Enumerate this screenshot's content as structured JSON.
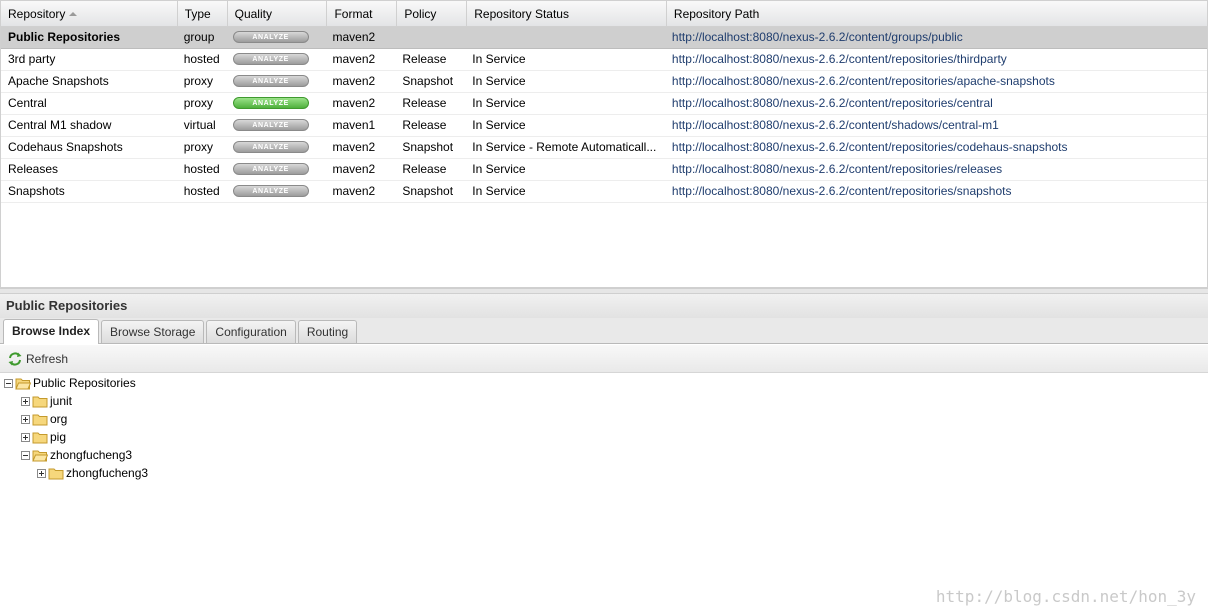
{
  "grid": {
    "columns": {
      "repository": "Repository",
      "type": "Type",
      "quality": "Quality",
      "format": "Format",
      "policy": "Policy",
      "status": "Repository Status",
      "path": "Repository Path"
    },
    "rows": [
      {
        "name": "Public Repositories",
        "type": "group",
        "analyze": "ANALYZE",
        "analyze_active": false,
        "format": "maven2",
        "policy": "",
        "status": "",
        "path": "http://localhost:8080/nexus-2.6.2/content/groups/public"
      },
      {
        "name": "3rd party",
        "type": "hosted",
        "analyze": "ANALYZE",
        "analyze_active": false,
        "format": "maven2",
        "policy": "Release",
        "status": "In Service",
        "path": "http://localhost:8080/nexus-2.6.2/content/repositories/thirdparty"
      },
      {
        "name": "Apache Snapshots",
        "type": "proxy",
        "analyze": "ANALYZE",
        "analyze_active": false,
        "format": "maven2",
        "policy": "Snapshot",
        "status": "In Service",
        "path": "http://localhost:8080/nexus-2.6.2/content/repositories/apache-snapshots"
      },
      {
        "name": "Central",
        "type": "proxy",
        "analyze": "ANALYZE",
        "analyze_active": true,
        "format": "maven2",
        "policy": "Release",
        "status": "In Service",
        "path": "http://localhost:8080/nexus-2.6.2/content/repositories/central"
      },
      {
        "name": "Central M1 shadow",
        "type": "virtual",
        "analyze": "ANALYZE",
        "analyze_active": false,
        "format": "maven1",
        "policy": "Release",
        "status": "In Service",
        "path": "http://localhost:8080/nexus-2.6.2/content/shadows/central-m1"
      },
      {
        "name": "Codehaus Snapshots",
        "type": "proxy",
        "analyze": "ANALYZE",
        "analyze_active": false,
        "format": "maven2",
        "policy": "Snapshot",
        "status": "In Service - Remote Automaticall...",
        "path": "http://localhost:8080/nexus-2.6.2/content/repositories/codehaus-snapshots"
      },
      {
        "name": "Releases",
        "type": "hosted",
        "analyze": "ANALYZE",
        "analyze_active": false,
        "format": "maven2",
        "policy": "Release",
        "status": "In Service",
        "path": "http://localhost:8080/nexus-2.6.2/content/repositories/releases"
      },
      {
        "name": "Snapshots",
        "type": "hosted",
        "analyze": "ANALYZE",
        "analyze_active": false,
        "format": "maven2",
        "policy": "Snapshot",
        "status": "In Service",
        "path": "http://localhost:8080/nexus-2.6.2/content/repositories/snapshots"
      }
    ]
  },
  "detail": {
    "title": "Public Repositories",
    "tabs": [
      "Browse Index",
      "Browse Storage",
      "Configuration",
      "Routing"
    ],
    "toolbar": {
      "refresh_label": "Refresh"
    },
    "tree": {
      "root": "Public Repositories",
      "children": [
        "junit",
        "org",
        "pig",
        "zhongfucheng3"
      ],
      "grandchild": "zhongfucheng3"
    }
  },
  "watermark": "http://blog.csdn.net/hon_3y"
}
